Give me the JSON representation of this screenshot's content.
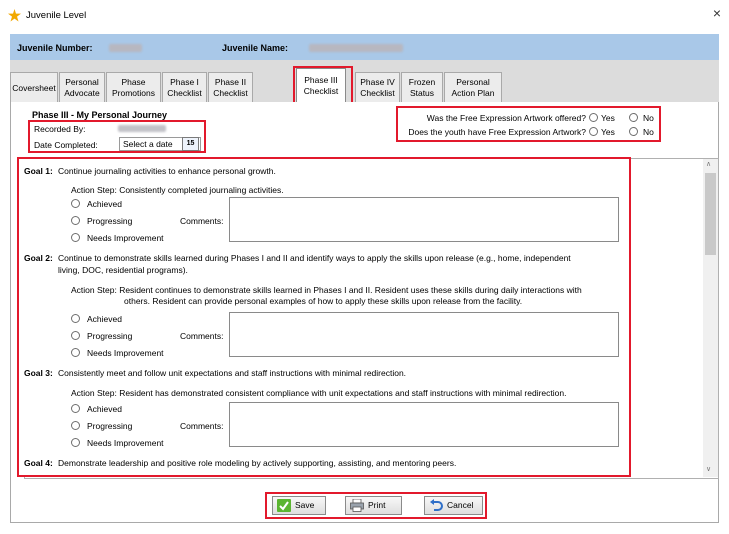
{
  "window": {
    "title": "Juvenile Level",
    "close": "×"
  },
  "header": {
    "juvenile_number_label": "Juvenile Number:",
    "juvenile_name_label": "Juvenile Name:"
  },
  "tabs": [
    {
      "line1": "Coversheet",
      "line2": ""
    },
    {
      "line1": "Personal",
      "line2": "Advocate"
    },
    {
      "line1": "Phase",
      "line2": "Promotions"
    },
    {
      "line1": "Phase I",
      "line2": "Checklist"
    },
    {
      "line1": "Phase II",
      "line2": "Checklist"
    },
    {
      "line1": "Phase III",
      "line2": "Checklist"
    },
    {
      "line1": "Phase IV",
      "line2": "Checklist"
    },
    {
      "line1": "Frozen",
      "line2": "Status"
    },
    {
      "line1": "Personal",
      "line2": "Action Plan"
    }
  ],
  "phase": {
    "title": "Phase III - My Personal Journey",
    "recorded_by_label": "Recorded By:",
    "date_completed_label": "Date Completed:",
    "date_placeholder": "Select a date",
    "calendar_day": "15"
  },
  "artwork": {
    "q1": "Was the Free Expression Artwork offered?",
    "q2": "Does the youth have Free Expression Artwork?",
    "yes": "Yes",
    "no": "No"
  },
  "options": {
    "achieved": "Achieved",
    "progressing": "Progressing",
    "needs": "Needs Improvement",
    "comments": "Comments:"
  },
  "goals": [
    {
      "label": "Goal 1:",
      "text": "Continue journaling activities to enhance personal growth.",
      "action": "Action Step: Consistently completed journaling activities."
    },
    {
      "label": "Goal 2:",
      "text": "Continue to demonstrate skills learned during Phases I and II and identify ways to apply the skills upon release (e.g., home, independent",
      "text2": "living, DOC, residential programs).",
      "action": "Action Step: Resident continues to demonstrate skills learned in Phases I and II. Resident uses these skills during daily interactions with",
      "action2": "others. Resident can provide personal examples of how to apply these skills upon release from the facility."
    },
    {
      "label": "Goal 3:",
      "text": "Consistently meet and follow unit expectations and staff instructions with minimal redirection.",
      "action": "Action Step: Resident has demonstrated consistent compliance with unit expectations and staff instructions with minimal redirection."
    },
    {
      "label": "Goal 4:",
      "text": "Demonstrate leadership and positive role modeling by actively supporting, assisting, and mentoring peers."
    }
  ],
  "buttons": {
    "save": "Save",
    "print": "Print",
    "cancel": "Cancel"
  }
}
